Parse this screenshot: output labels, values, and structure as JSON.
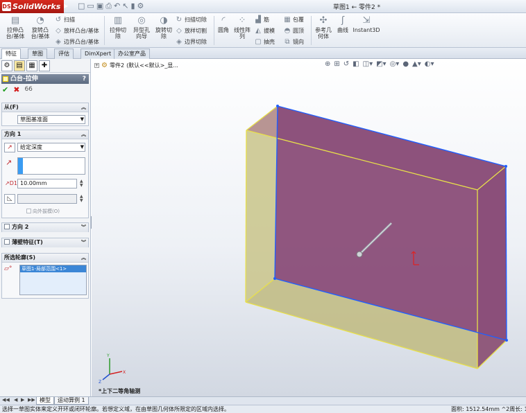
{
  "app": {
    "name": "SolidWorks",
    "logo_mark": "DS",
    "doc_title": "草图1 ← 零件2 *"
  },
  "quick_access": [
    "new-icon",
    "open-icon",
    "save-icon",
    "print-icon",
    "undo-icon",
    "select-icon",
    "rebuild-icon",
    "options-icon"
  ],
  "ribbon": {
    "extrude_boss": "拉伸凸\n台/基体",
    "revolve_boss": "旋转凸\n台/基体",
    "sweep": "扫描",
    "loft": "放样凸台/基体",
    "boundary_boss": "边界凸台/基体",
    "extrude_cut": "拉伸切\n除",
    "hole_wizard": "异型孔\n向导",
    "revolve_cut": "旋转切\n除",
    "swept_cut": "扫描切除",
    "lofted_cut": "放样切割",
    "boundary_cut": "边界切除",
    "fillet": "圆角",
    "linear_pattern": "线性阵\n列",
    "rib": "筋",
    "draft": "拔模",
    "shell": "抽壳",
    "wrap": "包覆",
    "dome": "圆顶",
    "mirror": "镜向",
    "reference_geometry": "参考几\n何体",
    "curves": "曲线",
    "instant3d": "Instant3D"
  },
  "tabs": [
    "特征",
    "草图",
    "评估",
    "DimXpert",
    "办公室产品"
  ],
  "active_tab": 0,
  "panel": {
    "feature_title": "凸台-拉伸",
    "help": "?",
    "from": {
      "header": "从(F)",
      "value": "草图基准面"
    },
    "direction1": {
      "header": "方向 1",
      "end_condition": "给定深度",
      "depth": "10.00mm",
      "draft_outward": "向外拔模(O)"
    },
    "direction2": {
      "header": "方向 2"
    },
    "thin_feature": {
      "header": "薄壁特征(T)"
    },
    "selected_contours": {
      "header": "所选轮廓(S)",
      "item": "草图1-局部范围<1>"
    }
  },
  "viewport": {
    "tree_part": "零件2",
    "tree_config": "(默认<<默认>_显...",
    "view_name": "*上下二等角轴测",
    "box_face_color": "#8a4d78",
    "box_side_color": "#c9c48a",
    "edge_blue": "#1f5fff",
    "edge_yellow": "#e8e04a"
  },
  "bottom_tabs": [
    "模型",
    "运动算例 1"
  ],
  "status": {
    "message": "选择一草图实体来定义开环或闭环轮廓。若想定义域，在由草图几何体所限定的区域内选择。",
    "area": "面积: 1512.54mm ^2周长: 1"
  }
}
